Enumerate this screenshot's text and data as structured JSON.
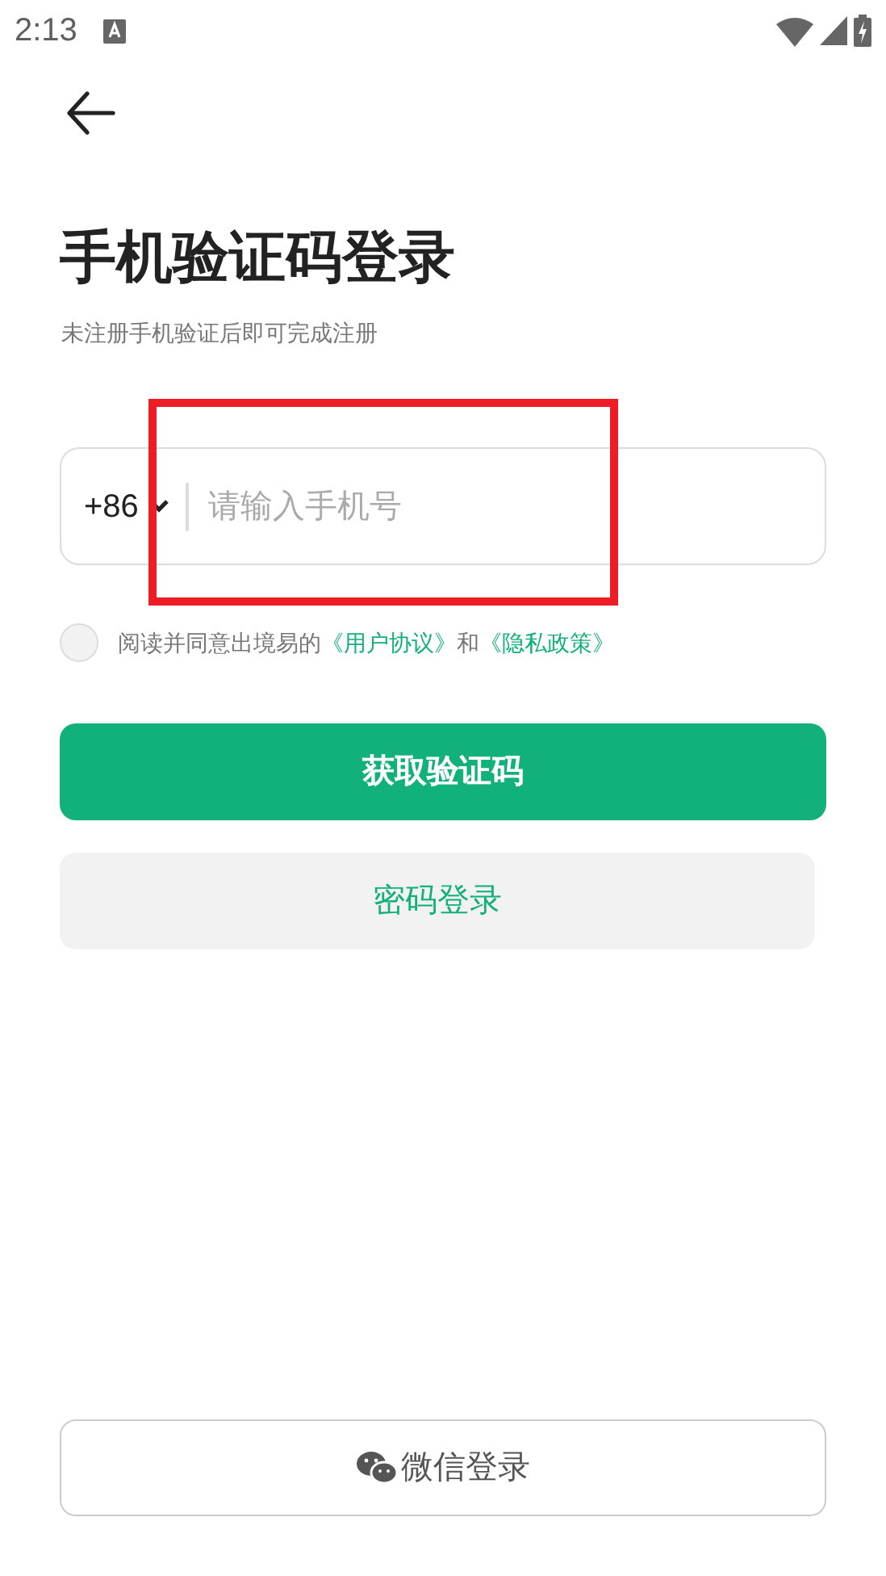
{
  "status_bar": {
    "time": "2:13"
  },
  "title": "手机验证码登录",
  "subtitle": "未注册手机验证后即可完成注册",
  "phone": {
    "country_code": "+86",
    "placeholder": "请输入手机号"
  },
  "consent": {
    "checked": false,
    "text": "阅读并同意出境易的",
    "link_1": "《用户协议》",
    "joiner": "和",
    "link_2": "《隐私政策》"
  },
  "buttons": [
    {
      "kind": "primary",
      "label": "获取验证码"
    },
    {
      "kind": "secondary",
      "label": "密码登录"
    }
  ],
  "wechat_button": {
    "label": "微信登录"
  },
  "annotation": {
    "kind": "highlight-box"
  }
}
